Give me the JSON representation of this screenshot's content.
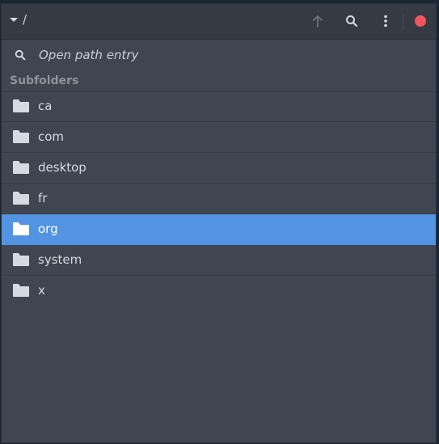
{
  "header": {
    "path": "/",
    "icons": {
      "dropdown": "chevron-down-icon",
      "up": "arrow-up-icon",
      "search": "search-icon",
      "menu": "more-vert-icon",
      "close": "close-icon"
    },
    "colors": {
      "close": "#f0545c",
      "up_disabled": "#6b717c"
    }
  },
  "search": {
    "placeholder": "Open path entry",
    "icon": "search-icon"
  },
  "section": {
    "title": "Subfolders"
  },
  "folders": [
    {
      "name": "ca",
      "selected": false
    },
    {
      "name": "com",
      "selected": false
    },
    {
      "name": "desktop",
      "selected": false
    },
    {
      "name": "fr",
      "selected": false
    },
    {
      "name": "org",
      "selected": true
    },
    {
      "name": "system",
      "selected": false
    },
    {
      "name": "x",
      "selected": false
    }
  ],
  "colors": {
    "background": "#3f4551",
    "header": "#353a44",
    "selection": "#5294e2",
    "text": "#d3dae3",
    "folder_icon": "#d3dae3"
  }
}
